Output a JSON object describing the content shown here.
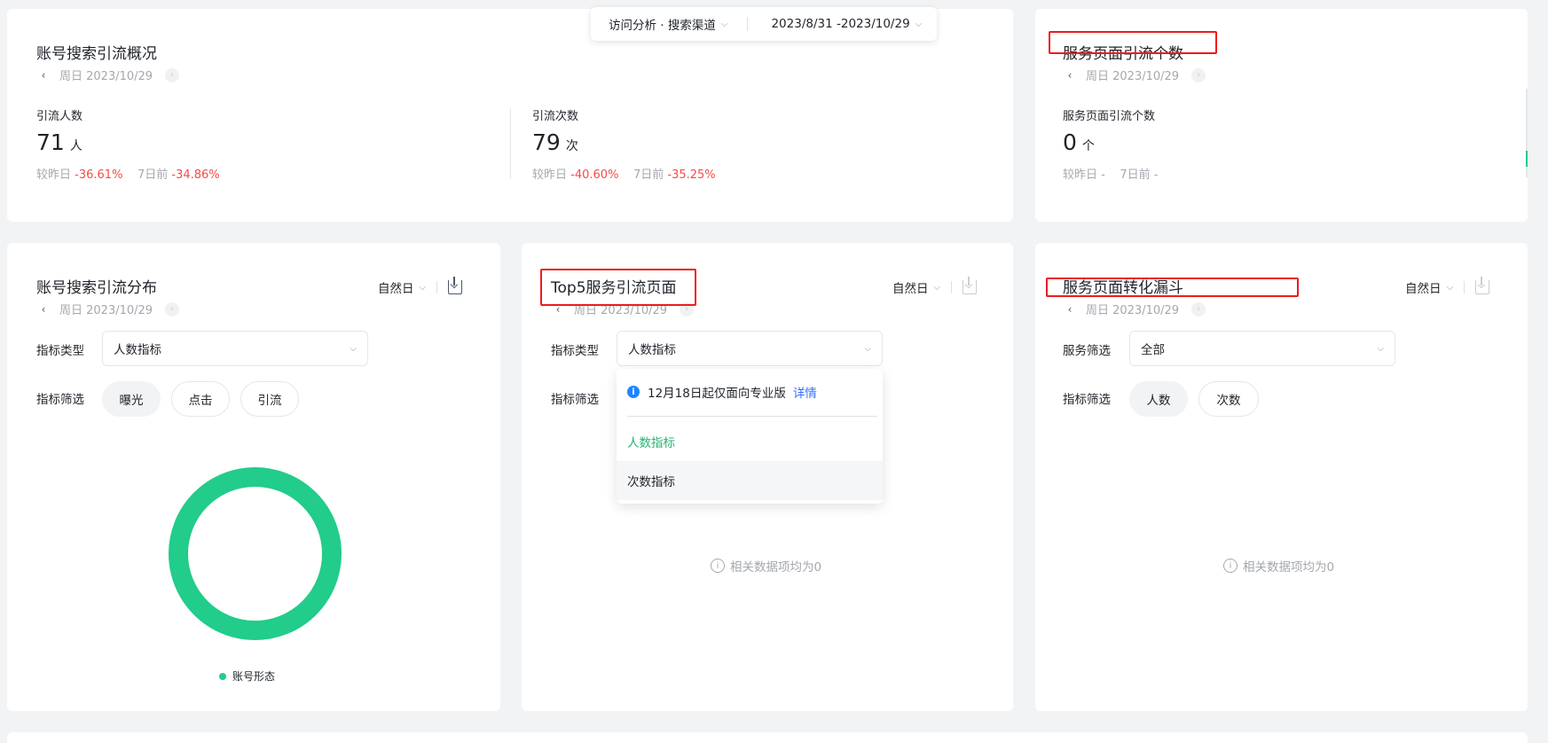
{
  "topbar": {
    "analysis_label": "访问分析 · 搜索渠道",
    "date_range": "2023/8/31 -2023/10/29"
  },
  "overview": {
    "title": "账号搜索引流概况",
    "date": "周日 2023/10/29",
    "metrics": [
      {
        "label": "引流人数",
        "value": "71",
        "unit": "人",
        "day_label": "较昨日",
        "day_change": "-36.61%",
        "week_label": "7日前",
        "week_change": "-34.86%"
      },
      {
        "label": "引流次数",
        "value": "79",
        "unit": "次",
        "day_label": "较昨日",
        "day_change": "-40.60%",
        "week_label": "7日前",
        "week_change": "-35.25%"
      }
    ]
  },
  "service_count": {
    "title": "服务页面引流个数",
    "date": "周日 2023/10/29",
    "metric": {
      "label": "服务页面引流个数",
      "value": "0",
      "unit": "个",
      "day_label": "较昨日",
      "day_change": "-",
      "week_label": "7日前",
      "week_change": "-"
    }
  },
  "distribution": {
    "title": "账号搜索引流分布",
    "period": "自然日",
    "date": "周日 2023/10/29",
    "type_label": "指标类型",
    "type_value": "人数指标",
    "filter_label": "指标筛选",
    "filters": [
      "曝光",
      "点击",
      "引流"
    ],
    "legend": "账号形态"
  },
  "top5": {
    "title": "Top5服务引流页面",
    "period": "自然日",
    "date": "周日 2023/10/29",
    "type_label": "指标类型",
    "type_value": "人数指标",
    "filter_label": "指标筛选",
    "notice": "12月18日起仅面向专业版",
    "notice_link": "详情",
    "options": [
      "人数指标",
      "次数指标"
    ],
    "empty": "相关数据项均为0"
  },
  "funnel": {
    "title": "服务页面转化漏斗",
    "period": "自然日",
    "date": "周日 2023/10/29",
    "service_label": "服务筛选",
    "service_value": "全部",
    "filter_label": "指标筛选",
    "filters": [
      "人数",
      "次数"
    ],
    "empty": "相关数据项均为0"
  },
  "chart_data": {
    "type": "pie",
    "categories": [
      "账号形态"
    ],
    "values": [
      100
    ],
    "colors": [
      "#22cc8a"
    ]
  }
}
